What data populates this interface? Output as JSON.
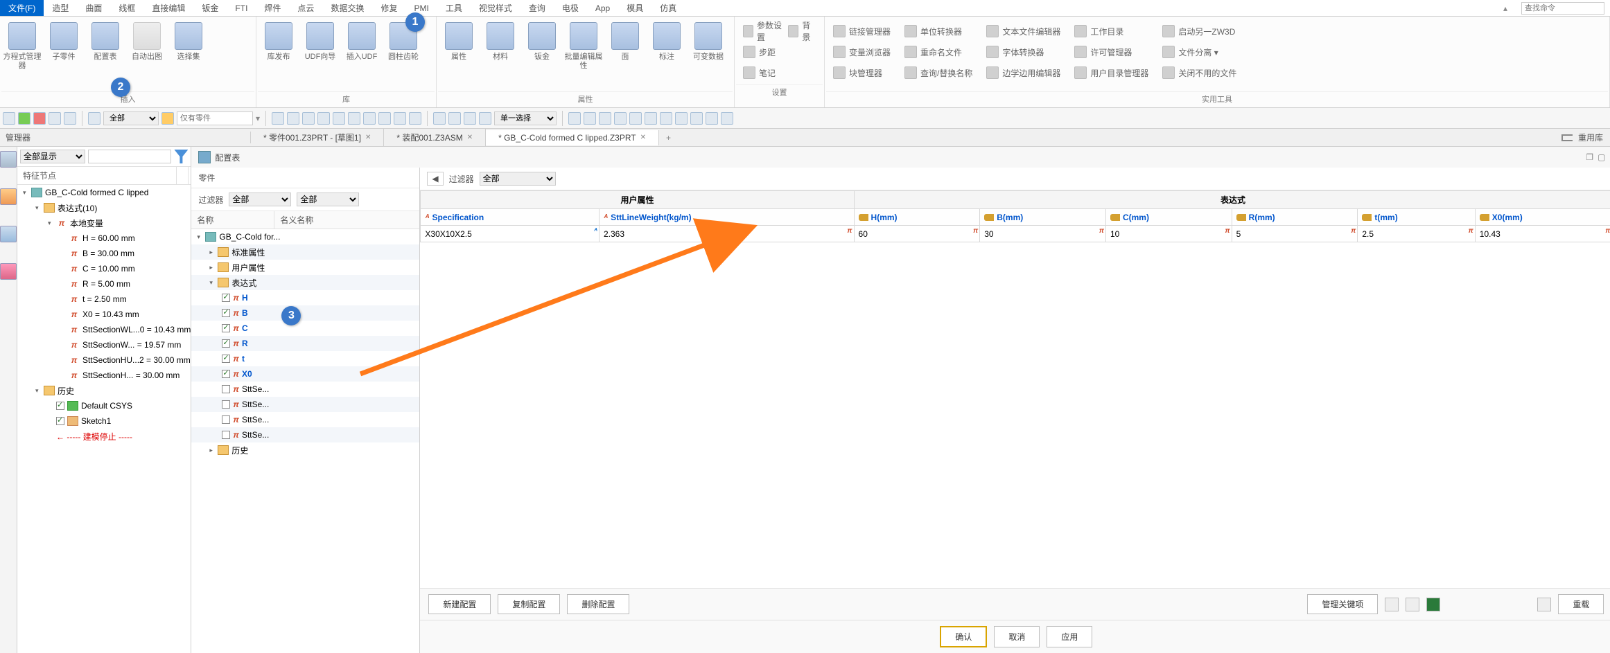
{
  "menu": {
    "items": [
      "文件(F)",
      "造型",
      "曲面",
      "线框",
      "直接编辑",
      "钣金",
      "FTI",
      "焊件",
      "点云",
      "数据交换",
      "修复",
      "PMI",
      "工具",
      "视觉样式",
      "查询",
      "电极",
      "App",
      "模具",
      "仿真"
    ],
    "active_index": 0,
    "search_placeholder": "查找命令"
  },
  "ribbon": {
    "groups": [
      {
        "label": "插入",
        "large": [
          "方程式管理器",
          "子零件",
          "配置表",
          "自动出图",
          "选择集"
        ]
      },
      {
        "label": "库",
        "large": [
          "库发布",
          "UDF向导",
          "插入UDF",
          "圆柱齿轮"
        ]
      },
      {
        "label": "属性",
        "large": [
          "属性",
          "材料",
          "钣金",
          "批量编辑属性",
          "面",
          "标注",
          "可变数据"
        ]
      },
      {
        "label": "设置",
        "rows": [
          [
            "参数设置",
            "背景"
          ],
          [
            "步距",
            ""
          ],
          [
            "笔记",
            ""
          ]
        ]
      },
      {
        "label": "实用工具",
        "cols": [
          [
            "链接管理器",
            "变量浏览器",
            "块管理器"
          ],
          [
            "单位转换器",
            "重命名文件",
            "查询/替换名称"
          ],
          [
            "文本文件编辑器",
            "字体转换器",
            "边学边用编辑器"
          ],
          [
            "工作目录",
            "许可管理器",
            "用户目录管理器"
          ],
          [
            "启动另一ZW3D",
            "文件分离 ▾",
            "关闭不用的文件"
          ]
        ]
      }
    ]
  },
  "toolbar2": {
    "dropdown1": "全部",
    "search_placeholder": "仅有零件",
    "select_mode": "单一选择"
  },
  "tabs": {
    "left_panel_label": "管理器",
    "files": [
      {
        "label": "* 零件001.Z3PRT - [草图1]",
        "closable": true,
        "active": false
      },
      {
        "label": "* 装配001.Z3ASM",
        "closable": true,
        "active": false
      },
      {
        "label": "* GB_C-Cold formed C lipped.Z3PRT",
        "closable": true,
        "active": true
      }
    ],
    "plus": "+",
    "right_label": "重用库"
  },
  "manager": {
    "view_mode": "全部显示",
    "header1": "特征节点",
    "tree": [
      {
        "indent": 0,
        "toggle": "▾",
        "ico": "part",
        "text": "GB_C-Cold formed C lipped"
      },
      {
        "indent": 1,
        "toggle": "▾",
        "ico": "folder",
        "text": "表达式(10)"
      },
      {
        "indent": 2,
        "toggle": "▾",
        "ico": "pi",
        "text": "本地变量"
      },
      {
        "indent": 3,
        "ico": "pi",
        "text": "H = 60.00 mm"
      },
      {
        "indent": 3,
        "ico": "pi",
        "text": "B = 30.00 mm"
      },
      {
        "indent": 3,
        "ico": "pi",
        "text": "C = 10.00 mm"
      },
      {
        "indent": 3,
        "ico": "pi",
        "text": "R = 5.00 mm"
      },
      {
        "indent": 3,
        "ico": "pi",
        "text": "t = 2.50 mm"
      },
      {
        "indent": 3,
        "ico": "pi",
        "text": "X0 = 10.43 mm"
      },
      {
        "indent": 3,
        "ico": "pi",
        "text": "SttSectionWL...0 = 10.43 mm"
      },
      {
        "indent": 3,
        "ico": "pi",
        "text": "SttSectionW... = 19.57 mm"
      },
      {
        "indent": 3,
        "ico": "pi",
        "text": "SttSectionHU...2 = 30.00 mm"
      },
      {
        "indent": 3,
        "ico": "pi",
        "text": "SttSectionH... = 30.00 mm"
      },
      {
        "indent": 1,
        "toggle": "▾",
        "ico": "folder",
        "text": "历史"
      },
      {
        "indent": 2,
        "chk": true,
        "ico": "green",
        "text": "Default CSYS"
      },
      {
        "indent": 2,
        "chk": true,
        "ico": "sketch",
        "text": "Sketch1"
      },
      {
        "indent": 2,
        "red": true,
        "text": "← ----- 建模停止 -----"
      }
    ]
  },
  "config": {
    "title": "配置表",
    "left": {
      "part_label": "零件",
      "filter_label": "过滤器",
      "filter1": "全部",
      "filter2": "全部",
      "col1": "名称",
      "col2": "名义名称",
      "tree": [
        {
          "indent": 0,
          "toggle": "▾",
          "ico": "part",
          "text": "GB_C-Cold for..."
        },
        {
          "indent": 1,
          "toggle": "▸",
          "ico": "folder",
          "text": "标准属性"
        },
        {
          "indent": 1,
          "toggle": "▸",
          "ico": "folder",
          "text": "用户属性"
        },
        {
          "indent": 1,
          "toggle": "▾",
          "ico": "folder",
          "text": "表达式"
        },
        {
          "indent": 2,
          "chk": true,
          "pi": true,
          "var": "H"
        },
        {
          "indent": 2,
          "chk": true,
          "pi": true,
          "var": "B"
        },
        {
          "indent": 2,
          "chk": true,
          "pi": true,
          "var": "C"
        },
        {
          "indent": 2,
          "chk": true,
          "pi": true,
          "var": "R"
        },
        {
          "indent": 2,
          "chk": true,
          "pi": true,
          "var": "t"
        },
        {
          "indent": 2,
          "chk": true,
          "pi": true,
          "var": "X0"
        },
        {
          "indent": 2,
          "chk": false,
          "pi": true,
          "text": "SttSe..."
        },
        {
          "indent": 2,
          "chk": false,
          "pi": true,
          "text": "SttSe..."
        },
        {
          "indent": 2,
          "chk": false,
          "pi": true,
          "text": "SttSe..."
        },
        {
          "indent": 2,
          "chk": false,
          "pi": true,
          "text": "SttSe..."
        },
        {
          "indent": 1,
          "toggle": "▸",
          "ico": "folder",
          "text": "历史"
        }
      ]
    },
    "right": {
      "nav_prev": "◀",
      "filter_label": "过滤器",
      "filter_value": "全部",
      "group1": "用户属性",
      "group2": "表达式",
      "cols": [
        "Specification",
        "SttLineWeight(kg/m)",
        "H(mm)",
        "B(mm)",
        "C(mm)",
        "R(mm)",
        "t(mm)",
        "X0(mm)"
      ],
      "row": [
        "X30X10X2.5",
        "2.363",
        "60",
        "30",
        "10",
        "5",
        "2.5",
        "10.43"
      ]
    },
    "buttons1": {
      "new": "新建配置",
      "copy": "复制配置",
      "delete": "删除配置",
      "keys": "管理关键项",
      "reload": "重载"
    },
    "buttons2": {
      "ok": "确认",
      "cancel": "取消",
      "apply": "应用"
    }
  },
  "badges": {
    "b1": "1",
    "b2": "2",
    "b3": "3"
  }
}
